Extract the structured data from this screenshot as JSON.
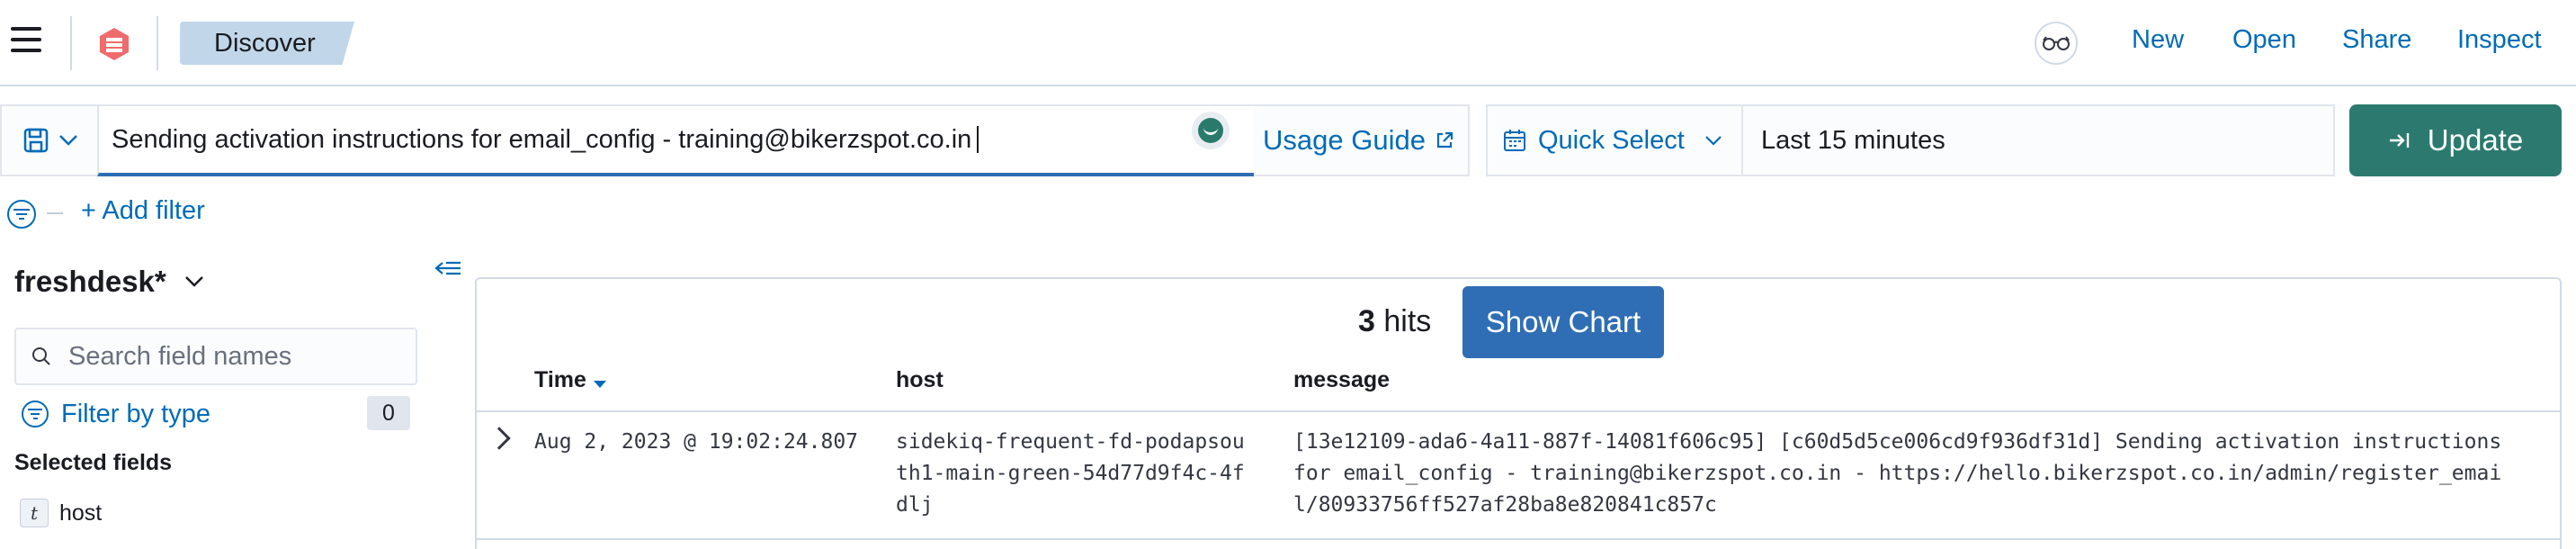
{
  "header": {
    "breadcrumb": "Discover",
    "links": {
      "new": "New",
      "open": "Open",
      "share": "Share",
      "inspect": "Inspect"
    },
    "icons": {
      "menu": "hamburger-icon",
      "logo": "elastic-logo-icon",
      "help": "glasses-icon"
    }
  },
  "query_bar": {
    "query": "Sending activation instructions for email_config - training@bikerzspot.co.in ",
    "usage_guide": "Usage Guide",
    "quick_select": "Quick Select",
    "time_range": "Last 15 minutes",
    "update": "Update"
  },
  "filters": {
    "add_filter": "+ Add filter"
  },
  "sidebar": {
    "index_pattern": "freshdesk*",
    "search_placeholder": "Search field names",
    "filter_by_type": "Filter by type",
    "filter_count": "0",
    "selected_fields_title": "Selected fields",
    "selected_fields": [
      {
        "type_badge": "t",
        "name": "host"
      }
    ]
  },
  "results": {
    "hit_count": "3",
    "hits_label": "hits",
    "show_chart": "Show Chart",
    "columns": [
      "Time",
      "host",
      "message"
    ],
    "rows": [
      {
        "time": "Aug 2, 2023 @ 19:02:24.807",
        "host_lines": [
          "sidekiq-frequent-fd-podapsou",
          "th1-main-green-54d77d9f4c-4f",
          "dlj"
        ],
        "message_lines": [
          "[13e12109-ada6-4a11-887f-14081f606c95] [c60d5d5ce006cd9f936df31d] Sending activation instructions",
          "for email_config - training@bikerzspot.co.in - https://hello.bikerzspot.co.in/admin/register_emai",
          "l/80933756ff527af28ba8e820841c857c"
        ]
      }
    ]
  },
  "colors": {
    "link": "#006bb8",
    "primary": "#2f6eb5",
    "update": "#2c7a6f",
    "breadcrumb_bg": "#c2d6ea"
  }
}
